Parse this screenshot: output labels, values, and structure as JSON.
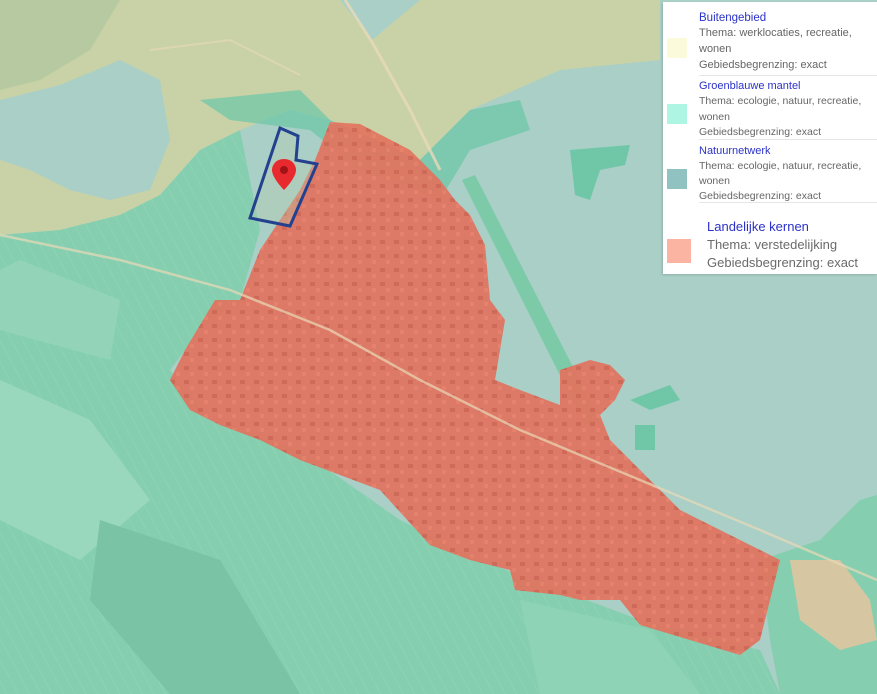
{
  "colors": {
    "water": "#a9cfc6",
    "green_mantle": "#6fc7a8",
    "farmland": "#85cfb0",
    "rural_land": "#c9d2a7",
    "urban_core": "#e2735e",
    "plot_outline": "#24418f",
    "marker": "#e8292d"
  },
  "map": {
    "marker_icon": "map-pin-icon"
  },
  "legend": {
    "items": [
      {
        "title": "Buitengebied",
        "lines": [
          "Thema: werklocaties, recreatie,",
          "wonen",
          "Gebiedsbegrenzing: exact"
        ],
        "color": "#fbfbdc"
      },
      {
        "title": "Groenblauwe mantel",
        "lines": [
          "Thema: ecologie, natuur, recreatie,",
          "wonen",
          "Gebiedsbegrenzing: exact"
        ],
        "color": "#aef5e4"
      },
      {
        "title": "Natuurnetwerk",
        "lines": [
          "Thema: ecologie, natuur, recreatie,",
          "wonen",
          "Gebiedsbegrenzing: exact"
        ],
        "color": "#8fc2c0"
      },
      {
        "title": "Landelijke kernen",
        "lines": [
          "Thema: verstedelijking",
          "Gebiedsbegrenzing: exact"
        ],
        "color": "#fbb4a2"
      }
    ]
  }
}
